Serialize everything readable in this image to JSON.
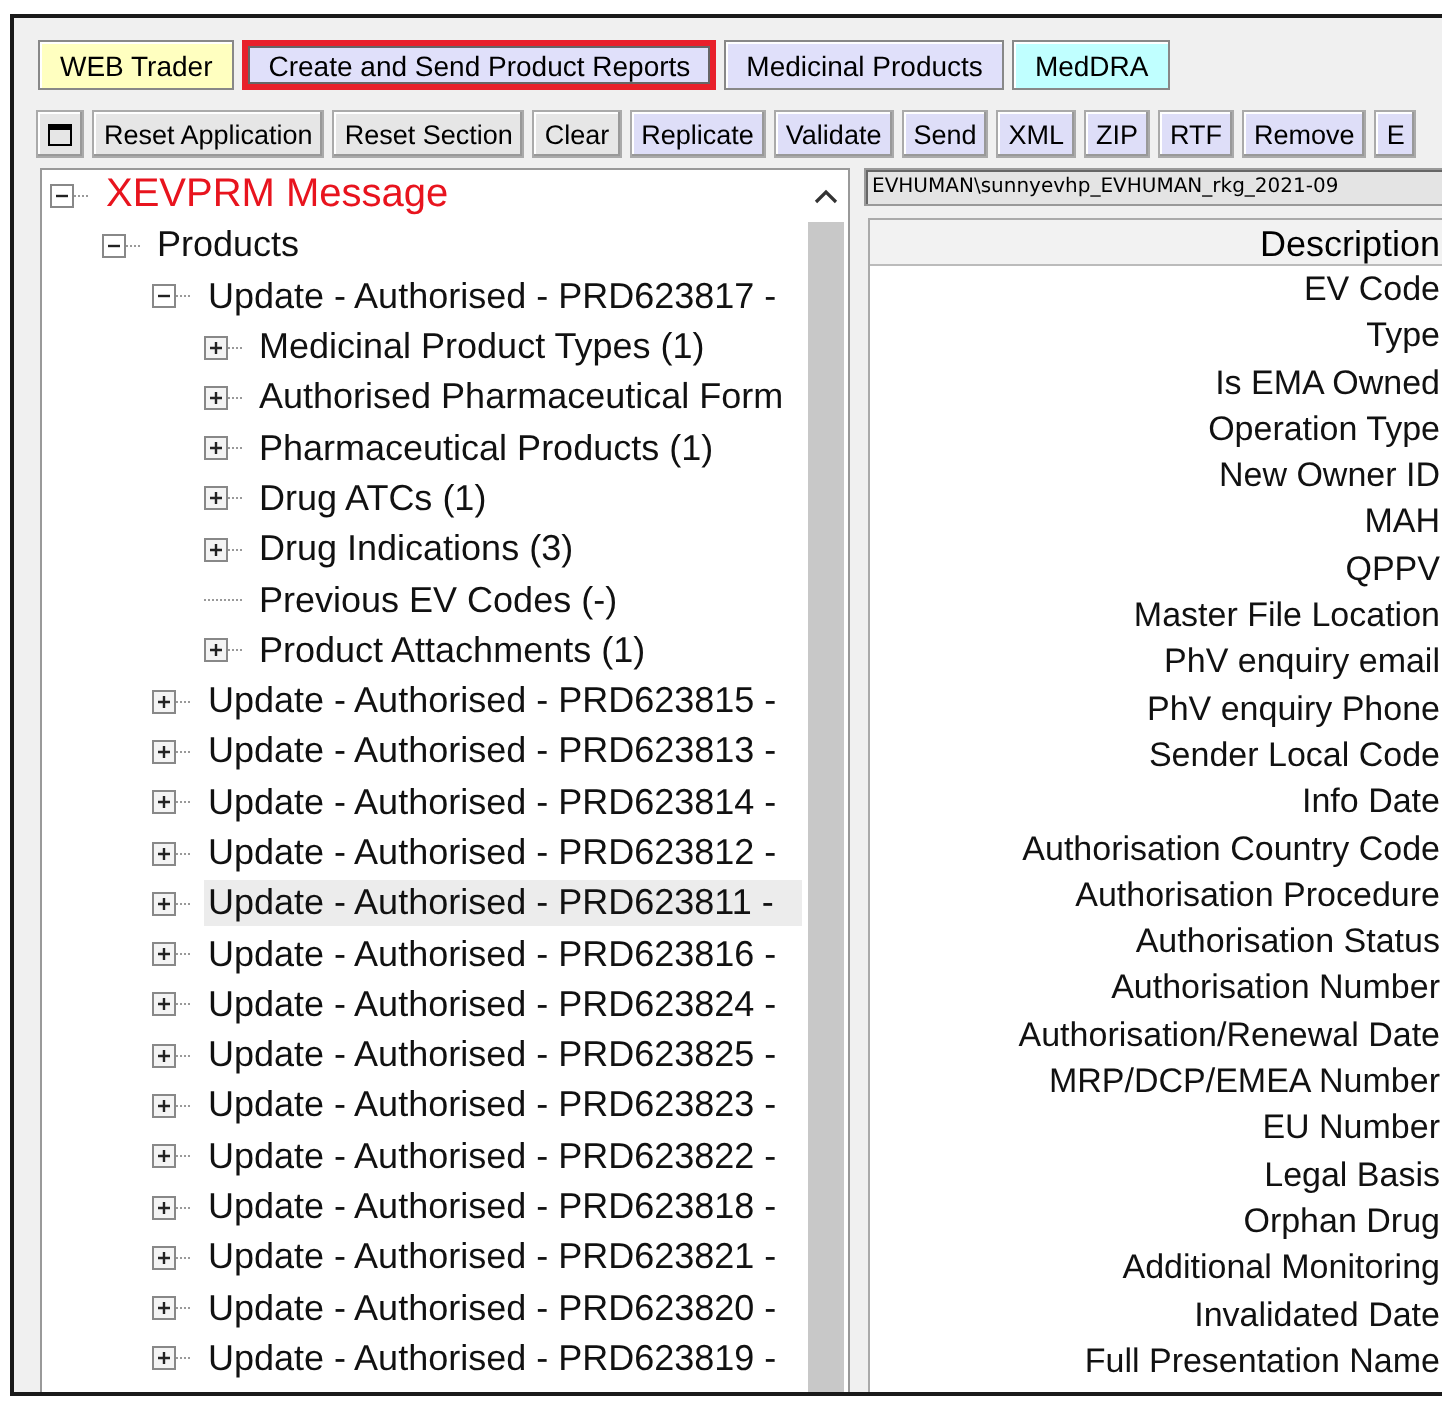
{
  "tabs": [
    {
      "label": "WEB Trader",
      "color": "#ffffc0",
      "highlighted": false
    },
    {
      "label": "Create and Send Product Reports",
      "color": "#e0e0fa",
      "highlighted": true
    },
    {
      "label": "Medicinal Products",
      "color": "#e0e0fa",
      "highlighted": false
    },
    {
      "label": "MedDRA",
      "color": "#c0ffff",
      "highlighted": false
    }
  ],
  "toolbar": [
    {
      "kind": "icon"
    },
    {
      "kind": "plain",
      "label": "Reset Application"
    },
    {
      "kind": "plain",
      "label": "Reset Section"
    },
    {
      "kind": "plain",
      "label": "Clear"
    },
    {
      "kind": "action",
      "label": "Replicate"
    },
    {
      "kind": "action",
      "label": "Validate"
    },
    {
      "kind": "action",
      "label": "Send"
    },
    {
      "kind": "action",
      "label": "XML"
    },
    {
      "kind": "action",
      "label": "ZIP"
    },
    {
      "kind": "action",
      "label": "RTF"
    },
    {
      "kind": "action",
      "label": "Remove"
    },
    {
      "kind": "action",
      "label": "E"
    }
  ],
  "tree": [
    {
      "label": "XEVPRM Message",
      "expanded": true,
      "leaf": false,
      "selected": false,
      "children": [
        {
          "label": "Products",
          "expanded": true,
          "leaf": false,
          "selected": false,
          "children": [
            {
              "label": "Update - Authorised - PRD623817 -",
              "expanded": true,
              "leaf": false,
              "selected": false,
              "children": [
                {
                  "label": "Medicinal Product Types (1)",
                  "expanded": false,
                  "leaf": false,
                  "selected": false
                },
                {
                  "label": "Authorised Pharmaceutical Form",
                  "expanded": false,
                  "leaf": false,
                  "selected": false
                },
                {
                  "label": "Pharmaceutical Products (1)",
                  "expanded": false,
                  "leaf": false,
                  "selected": false
                },
                {
                  "label": "Drug ATCs (1)",
                  "expanded": false,
                  "leaf": false,
                  "selected": false
                },
                {
                  "label": "Drug Indications (3)",
                  "expanded": false,
                  "leaf": false,
                  "selected": false
                },
                {
                  "label": "Previous EV Codes (-)",
                  "leaf": true,
                  "selected": false
                },
                {
                  "label": "Product Attachments (1)",
                  "expanded": false,
                  "leaf": false,
                  "selected": false
                }
              ]
            },
            {
              "label": "Update - Authorised - PRD623815 -",
              "expanded": false,
              "leaf": false,
              "selected": false
            },
            {
              "label": "Update - Authorised - PRD623813 -",
              "expanded": false,
              "leaf": false,
              "selected": false
            },
            {
              "label": "Update - Authorised - PRD623814 -",
              "expanded": false,
              "leaf": false,
              "selected": false
            },
            {
              "label": "Update - Authorised - PRD623812 -",
              "expanded": false,
              "leaf": false,
              "selected": false
            },
            {
              "label": "Update - Authorised - PRD623811 -",
              "expanded": false,
              "leaf": false,
              "selected": true
            },
            {
              "label": "Update - Authorised - PRD623816 -",
              "expanded": false,
              "leaf": false,
              "selected": false
            },
            {
              "label": "Update - Authorised - PRD623824 -",
              "expanded": false,
              "leaf": false,
              "selected": false
            },
            {
              "label": "Update - Authorised - PRD623825 -",
              "expanded": false,
              "leaf": false,
              "selected": false
            },
            {
              "label": "Update - Authorised - PRD623823 -",
              "expanded": false,
              "leaf": false,
              "selected": false
            },
            {
              "label": "Update - Authorised - PRD623822 -",
              "expanded": false,
              "leaf": false,
              "selected": false
            },
            {
              "label": "Update - Authorised - PRD623818 -",
              "expanded": false,
              "leaf": false,
              "selected": false
            },
            {
              "label": "Update - Authorised - PRD623821 -",
              "expanded": false,
              "leaf": false,
              "selected": false
            },
            {
              "label": "Update - Authorised - PRD623820 -",
              "expanded": false,
              "leaf": false,
              "selected": false
            },
            {
              "label": "Update - Authorised - PRD623819 -",
              "expanded": false,
              "leaf": false,
              "selected": false
            }
          ]
        }
      ]
    }
  ],
  "path_field": {
    "value": "EVHUMAN\\sunnyevhp_EVHUMAN_rkg_2021-09"
  },
  "table": {
    "columns": [
      "Description"
    ],
    "rows": [
      "EV Code",
      "Type",
      "Is EMA Owned",
      "Operation Type",
      "New Owner ID",
      "MAH",
      "QPPV",
      "Master File Location",
      "PhV enquiry email",
      "PhV enquiry Phone",
      "Sender Local Code",
      "Info Date",
      "Authorisation Country Code",
      "Authorisation Procedure",
      "Authorisation Status",
      "Authorisation Number",
      "Authorisation/Renewal Date",
      "MRP/DCP/EMEA Number",
      "EU Number",
      "Legal Basis",
      "Orphan Drug",
      "Additional Monitoring",
      "Invalidated Date",
      "Full Presentation Name"
    ]
  }
}
